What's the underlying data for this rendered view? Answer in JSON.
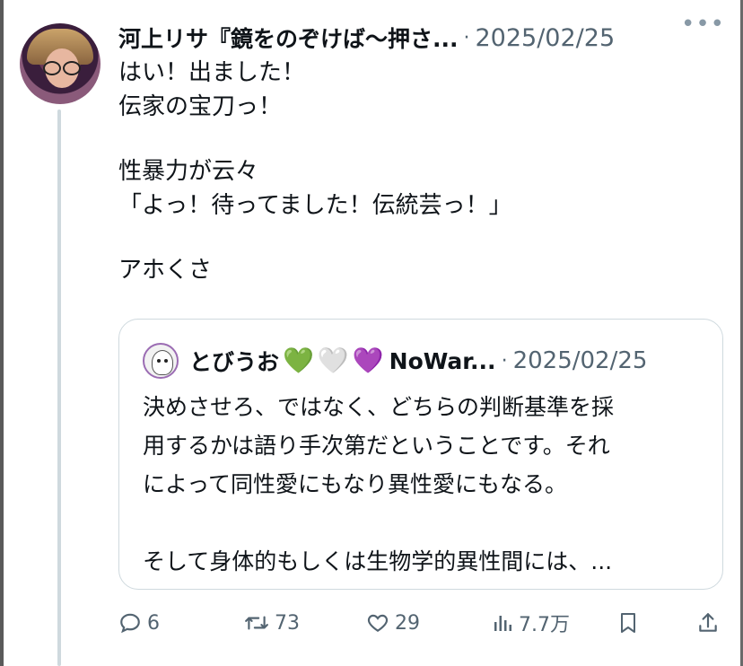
{
  "tweet": {
    "author_name": "河上リサ『鏡をのぞけば〜押さ...",
    "separator": "·",
    "date": "2025/02/25",
    "more_label": "•••",
    "body_lines": [
      "はい！出ました！",
      "伝家の宝刀っ！",
      "",
      "性暴力が云々",
      "「よっ！待ってました！伝統芸っ！」",
      "",
      "アホくさ"
    ]
  },
  "quote": {
    "author_name": "とびうお",
    "hearts": [
      "💚",
      "🤍",
      "💜"
    ],
    "author_name_suffix": "NoWar...",
    "separator": "·",
    "date": "2025/02/25",
    "body_lines": [
      "決めさせろ、ではなく、どちらの判断基準を採",
      "用するかは語り手次第だということです。それ",
      "によって同性愛にもなり異性愛にもなる。",
      "",
      "そして身体的もしくは生物学的異性間には、..."
    ]
  },
  "actions": {
    "replies": "6",
    "reposts": "73",
    "likes": "29",
    "views": "7.7万"
  },
  "colors": {
    "text": "#0f1419",
    "muted": "#536471",
    "border": "#cfd9de"
  },
  "icons": [
    "more-icon",
    "reply-icon",
    "repost-icon",
    "like-icon",
    "views-icon",
    "bookmark-icon",
    "share-icon"
  ]
}
